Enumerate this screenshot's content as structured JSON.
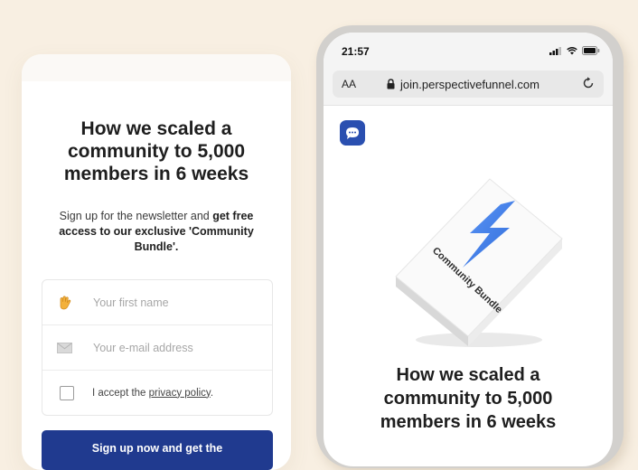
{
  "left_card": {
    "heading": "How we scaled a community to 5,000 members in 6 weeks",
    "subtitle_plain": "Sign up for the newsletter and ",
    "subtitle_bold": "get free access to our exclusive 'Community Bundle'.",
    "first_name_placeholder": "Your first name",
    "email_placeholder": "Your e-mail address",
    "consent_prefix": "I accept the ",
    "consent_link": "privacy policy",
    "consent_suffix": ".",
    "submit_label": "Sign up now and get the"
  },
  "phone": {
    "time": "21:57",
    "aa_label": "AA",
    "url": "join.perspectivefunnel.com",
    "box_label": "Community Bundle",
    "heading": "How we scaled a community to 5,000 members in 6 weeks"
  },
  "colors": {
    "background": "#f8efe2",
    "button": "#203a8f",
    "chat_icon": "#2a4fb0"
  }
}
